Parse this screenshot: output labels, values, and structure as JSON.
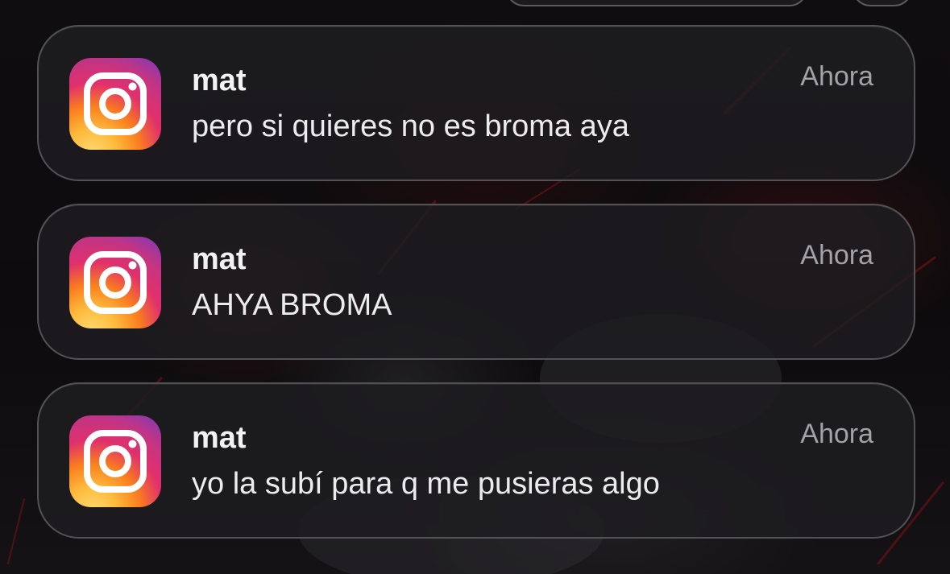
{
  "notifications": [
    {
      "app_icon": "instagram-icon",
      "sender": "mat",
      "message": "pero si quieres no es broma aya",
      "time": "Ahora"
    },
    {
      "app_icon": "instagram-icon",
      "sender": "mat",
      "message": "AHYA BROMA",
      "time": "Ahora"
    },
    {
      "app_icon": "instagram-icon",
      "sender": "mat",
      "message": "yo la subí para q me pusieras algo",
      "time": "Ahora"
    }
  ],
  "colors": {
    "card_background": "#1e1d20",
    "sender_text": "#f2f2f4",
    "time_text": "#a3a2a7",
    "instagram_gradient": [
      "#feda75",
      "#fa7e1e",
      "#d62976",
      "#962fbf",
      "#4f5bd5"
    ]
  }
}
